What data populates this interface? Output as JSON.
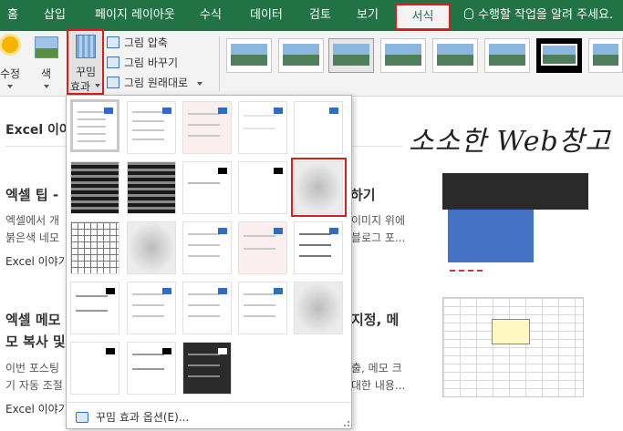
{
  "tabs": [
    "홈",
    "삽입",
    "페이지 레이아웃",
    "수식",
    "데이터",
    "검토",
    "보기"
  ],
  "active_tab": "서식",
  "tell_me": "수행할 작업을 알려 주세요.",
  "ribbon": {
    "correct_label": "수정",
    "color_label": "색",
    "artistic_label_line1": "꾸밈",
    "artistic_label_line2": "효과",
    "compress": "그림 압축",
    "change": "그림 바꾸기",
    "reset": "그림 원래대로"
  },
  "page": {
    "section_title": "Excel 이야",
    "heading1": "엑셀 팁 -",
    "heading1_tail": "하기",
    "text1_a": "엑셀에서 개",
    "text1_b": "붉은색 네모",
    "text1_tail_a": "이미지 위에",
    "text1_tail_b": "블로그 포...",
    "category1": "Excel 이야기",
    "heading2": "엑셀 메모",
    "heading2_line2": "모 복사 및",
    "heading2_tail": "지정, 메",
    "text2_a": "이번 포스팅",
    "text2_b": "기 자동 조절",
    "text2_tail_a": "출, 메모 크",
    "text2_tail_b": "대한 내용...",
    "category2": "Excel 이야기",
    "watermark": "소소한 Web창고"
  },
  "gallery": {
    "options_label": "꾸밈 효과 옵션(E)..."
  }
}
